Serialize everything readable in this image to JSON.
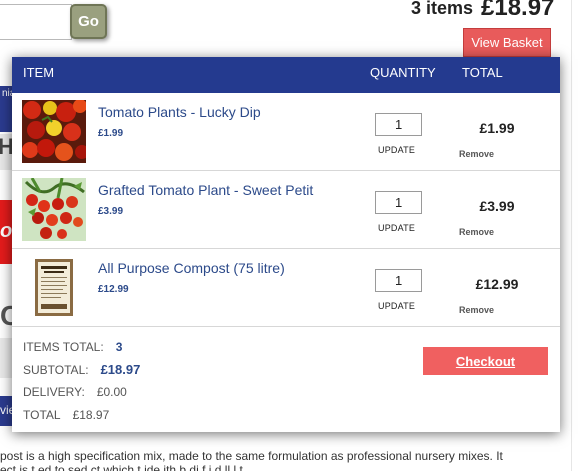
{
  "header": {
    "search_button": "Go",
    "items_count": "3 items",
    "basket_total": "£18.97",
    "view_basket": "View Basket"
  },
  "background": {
    "frag_nav": "nia",
    "frag_h": "H",
    "frag_red": "o",
    "frag_c": "C",
    "frag_view": "vie",
    "description_line1": "post is a high specification mix, made to the same formulation as professional nursery mixes. It",
    "description_line2": "ect is t ed to sed ct which t ide ith b di f i d ll l t"
  },
  "basket": {
    "columns": {
      "item": "ITEM",
      "quantity": "QUANTITY",
      "total": "TOTAL"
    },
    "items": [
      {
        "name": "Tomato Plants - Lucky Dip",
        "price": "£1.99",
        "qty": "1",
        "update": "UPDATE",
        "total": "£1.99",
        "remove": "Remove",
        "icon": "tomato-cluster-image"
      },
      {
        "name": "Grafted Tomato Plant - Sweet Petit",
        "price": "£3.99",
        "qty": "1",
        "update": "UPDATE",
        "total": "£3.99",
        "remove": "Remove",
        "icon": "tomato-vine-image"
      },
      {
        "name": "All Purpose Compost (75 litre)",
        "price": "£12.99",
        "qty": "1",
        "update": "UPDATE",
        "total": "£12.99",
        "remove": "Remove",
        "icon": "compost-bag-image"
      }
    ],
    "summary": {
      "items_total_label": "ITEMS TOTAL:",
      "items_total_value": "3",
      "subtotal_label": "SUBTOTAL:",
      "subtotal_value": "£18.97",
      "delivery_label": "DELIVERY:",
      "delivery_value": "£0.00",
      "total_label": "TOTAL",
      "total_value": "£18.97"
    },
    "checkout": "Checkout"
  },
  "colors": {
    "header_blue": "#243a8f",
    "accent_red": "#f06060",
    "link_blue": "#2c4a8a",
    "go_button": "#9aa07f"
  }
}
